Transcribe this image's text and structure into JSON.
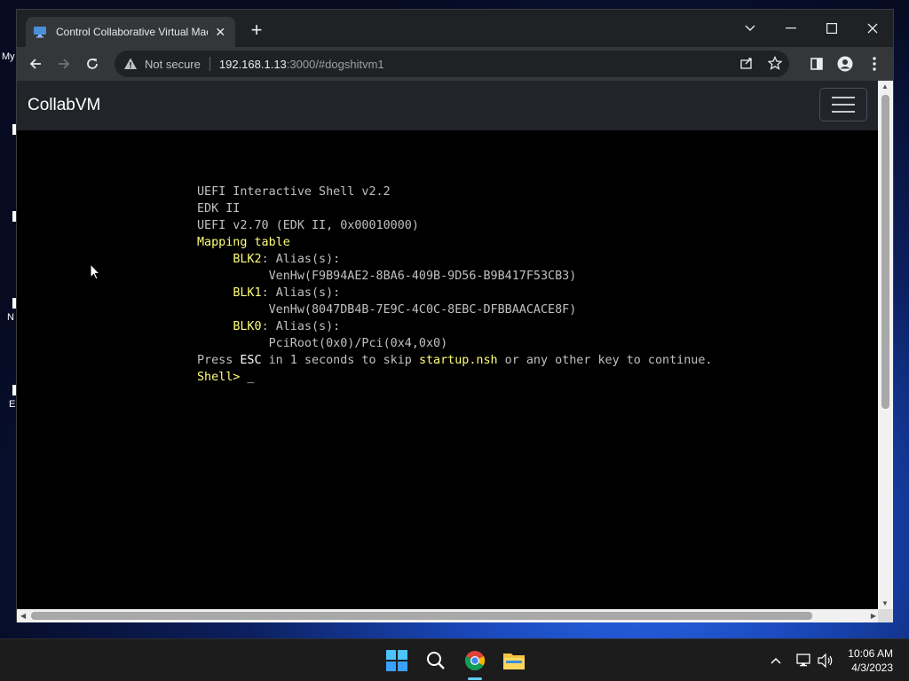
{
  "desktop": {
    "icon_labels": [
      "My",
      "N",
      "E"
    ]
  },
  "browser": {
    "tab": {
      "title": "Control Collaborative Virtual Mac"
    },
    "address_bar": {
      "security_label": "Not secure",
      "url_host": "192.168.1.13",
      "url_rest": ":3000/#dogshitvm1"
    }
  },
  "page": {
    "brand": "CollabVM"
  },
  "console": {
    "line1": "UEFI Interactive Shell v2.2",
    "line2": "EDK II",
    "line3": "UEFI v2.70 (EDK II, 0x00010000)",
    "line4": "Mapping table",
    "blk2_name": "BLK2",
    "alias_label": "Alias(s):",
    "blk2_path": "VenHw(F9B94AE2-8BA6-409B-9D56-B9B417F53CB3)",
    "blk1_name": "BLK1",
    "blk1_path": "VenHw(8047DB4B-7E9C-4C0C-8EBC-DFBBAACACE8F)",
    "blk0_name": "BLK0",
    "blk0_path": "PciRoot(0x0)/Pci(0x4,0x0)",
    "press_prefix": "Press ",
    "press_key": "ESC",
    "press_mid": " in 1 seconds to skip ",
    "press_script": "startup.nsh",
    "press_suffix": " or any other key to continue.",
    "prompt": "Shell>",
    "cursor": " _"
  },
  "taskbar": {
    "time": "10:06 AM",
    "date": "4/3/2023",
    "icons": [
      "windows-start-icon",
      "search-icon",
      "chrome-icon",
      "file-explorer-icon"
    ]
  },
  "colors": {
    "console_text": "#c0c0c0",
    "console_highlight": "#ffff78",
    "navbar_bg": "#212529",
    "accent": "#60cdff"
  }
}
